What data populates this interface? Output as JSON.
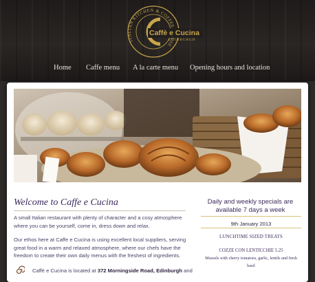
{
  "logo": {
    "brand": "Caffè e Cucina",
    "arc_text": "ITALIAN KITCHEN & COFFEE HOUSE",
    "city": "EDINBURGH"
  },
  "nav": {
    "items": [
      {
        "label": "Home"
      },
      {
        "label": "Caffe menu"
      },
      {
        "label": "A la carte menu"
      },
      {
        "label": "Opening hours and location"
      }
    ]
  },
  "welcome": {
    "title": "Welcome to Caffe e Cucina",
    "paragraph1": "A small Italian restaurant with plenty of character and a cosy atmosphere where you can be yourself, come in, dress down and relax.",
    "paragraph2": "Our ethos here at Caffe e Cucina is using excellent local suppliers, serving great food in a warm and relaxed atmosphere, where our chefs have the freedom to create their own daily menus with the freshest of ingredients.",
    "location_prefix": "Caffè e Cucina is located at ",
    "location_address": "372 Morningside Road, Edinburgh",
    "location_suffix": " and"
  },
  "specials": {
    "title": "Daily and weekly specials are available 7 days a week",
    "date": "9th January 2013",
    "section": "LUNCHTIME SIZED TREATS",
    "item_name": "COZZE CON LENTICCHIE 5.25",
    "item_desc": "Mussels with cherry tomatoes, garlic, lentils and fresh basil"
  },
  "colors": {
    "accent_gold": "#c8a64a",
    "heading_purple": "#3b2a5a",
    "header_dark": "#221f1d"
  }
}
